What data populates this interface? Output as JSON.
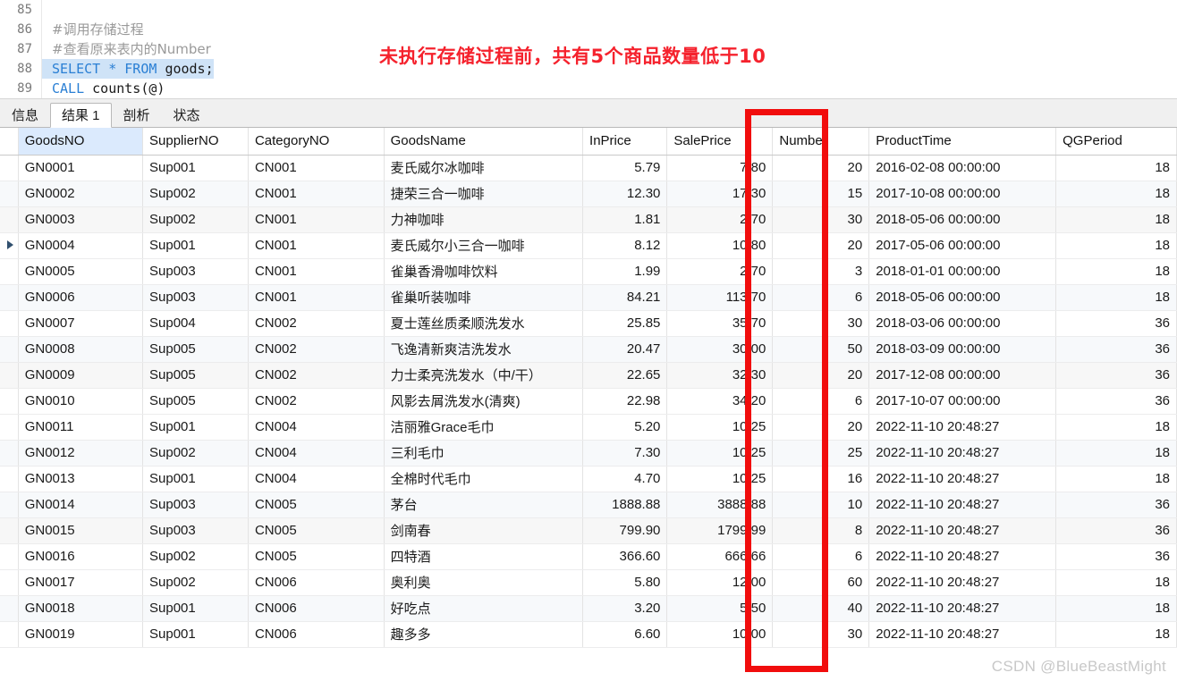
{
  "editor": {
    "lines": [
      {
        "no": "85",
        "tokens": [
          {
            "t": "",
            "cls": "plain"
          }
        ],
        "selected": false
      },
      {
        "no": "86",
        "tokens": [
          {
            "t": "#调用存储过程",
            "cls": "comment"
          }
        ],
        "selected": false
      },
      {
        "no": "87",
        "tokens": [
          {
            "t": "#查看原来表内的Number",
            "cls": "comment"
          }
        ],
        "selected": false
      },
      {
        "no": "88",
        "tokens": [
          {
            "t": "SELECT * FROM ",
            "cls": "kw"
          },
          {
            "t": "goods;",
            "cls": "plain"
          }
        ],
        "selected": true
      },
      {
        "no": "89",
        "tokens": [
          {
            "t": "CALL ",
            "cls": "kw"
          },
          {
            "t": "counts(@)",
            "cls": "plain"
          }
        ],
        "selected": false
      }
    ]
  },
  "annotation": {
    "text": "未执行存储过程前，共有5个商品数量低于10",
    "color": "#f5222d"
  },
  "tabs": [
    {
      "label": "信息",
      "active": false
    },
    {
      "label": "结果 1",
      "active": true
    },
    {
      "label": "剖析",
      "active": false
    },
    {
      "label": "状态",
      "active": false
    }
  ],
  "grid": {
    "columns": [
      {
        "key": "GoodsNO",
        "label": "GoodsNO",
        "align": "left",
        "highlight": true
      },
      {
        "key": "SupplierNO",
        "label": "SupplierNO",
        "align": "left",
        "highlight": false
      },
      {
        "key": "CategoryNO",
        "label": "CategoryNO",
        "align": "left",
        "highlight": false
      },
      {
        "key": "GoodsName",
        "label": "GoodsName",
        "align": "left",
        "highlight": false
      },
      {
        "key": "InPrice",
        "label": "InPrice",
        "align": "left",
        "highlight": false
      },
      {
        "key": "SalePrice",
        "label": "SalePrice",
        "align": "left",
        "highlight": false
      },
      {
        "key": "Number",
        "label": "Number",
        "align": "left",
        "highlight": false
      },
      {
        "key": "ProductTime",
        "label": "ProductTime",
        "align": "left",
        "highlight": false
      },
      {
        "key": "QGPeriod",
        "label": "QGPeriod",
        "align": "left",
        "highlight": false
      }
    ],
    "selected_row_index": 3,
    "rows": [
      {
        "GoodsNO": "GN0001",
        "SupplierNO": "Sup001",
        "CategoryNO": "CN001",
        "GoodsName": "麦氏威尔冰咖啡",
        "InPrice": "5.79",
        "SalePrice": "7.80",
        "Number": "20",
        "ProductTime": "2016-02-08 00:00:00",
        "QGPeriod": "18"
      },
      {
        "GoodsNO": "GN0002",
        "SupplierNO": "Sup002",
        "CategoryNO": "CN001",
        "GoodsName": "捷荣三合一咖啡",
        "InPrice": "12.30",
        "SalePrice": "17.30",
        "Number": "15",
        "ProductTime": "2017-10-08 00:00:00",
        "QGPeriod": "18"
      },
      {
        "GoodsNO": "GN0003",
        "SupplierNO": "Sup002",
        "CategoryNO": "CN001",
        "GoodsName": "力神咖啡",
        "InPrice": "1.81",
        "SalePrice": "2.70",
        "Number": "30",
        "ProductTime": "2018-05-06 00:00:00",
        "QGPeriod": "18"
      },
      {
        "GoodsNO": "GN0004",
        "SupplierNO": "Sup001",
        "CategoryNO": "CN001",
        "GoodsName": "麦氏威尔小三合一咖啡",
        "InPrice": "8.12",
        "SalePrice": "10.80",
        "Number": "20",
        "ProductTime": "2017-05-06 00:00:00",
        "QGPeriod": "18"
      },
      {
        "GoodsNO": "GN0005",
        "SupplierNO": "Sup003",
        "CategoryNO": "CN001",
        "GoodsName": "雀巢香滑咖啡饮料",
        "InPrice": "1.99",
        "SalePrice": "2.70",
        "Number": "3",
        "ProductTime": "2018-01-01 00:00:00",
        "QGPeriod": "18"
      },
      {
        "GoodsNO": "GN0006",
        "SupplierNO": "Sup003",
        "CategoryNO": "CN001",
        "GoodsName": "雀巢听装咖啡",
        "InPrice": "84.21",
        "SalePrice": "113.70",
        "Number": "6",
        "ProductTime": "2018-05-06 00:00:00",
        "QGPeriod": "18"
      },
      {
        "GoodsNO": "GN0007",
        "SupplierNO": "Sup004",
        "CategoryNO": "CN002",
        "GoodsName": "夏士莲丝质柔顺洗发水",
        "InPrice": "25.85",
        "SalePrice": "35.70",
        "Number": "30",
        "ProductTime": "2018-03-06 00:00:00",
        "QGPeriod": "36"
      },
      {
        "GoodsNO": "GN0008",
        "SupplierNO": "Sup005",
        "CategoryNO": "CN002",
        "GoodsName": "飞逸清新爽洁洗发水",
        "InPrice": "20.47",
        "SalePrice": "30.00",
        "Number": "50",
        "ProductTime": "2018-03-09 00:00:00",
        "QGPeriod": "36"
      },
      {
        "GoodsNO": "GN0009",
        "SupplierNO": "Sup005",
        "CategoryNO": "CN002",
        "GoodsName": "力士柔亮洗发水（中/干）",
        "InPrice": "22.65",
        "SalePrice": "32.30",
        "Number": "20",
        "ProductTime": "2017-12-08 00:00:00",
        "QGPeriod": "36"
      },
      {
        "GoodsNO": "GN0010",
        "SupplierNO": "Sup005",
        "CategoryNO": "CN002",
        "GoodsName": "风影去屑洗发水(清爽)",
        "InPrice": "22.98",
        "SalePrice": "34.20",
        "Number": "6",
        "ProductTime": "2017-10-07 00:00:00",
        "QGPeriod": "36"
      },
      {
        "GoodsNO": "GN0011",
        "SupplierNO": "Sup001",
        "CategoryNO": "CN004",
        "GoodsName": "洁丽雅Grace毛巾",
        "InPrice": "5.20",
        "SalePrice": "10.25",
        "Number": "20",
        "ProductTime": "2022-11-10 20:48:27",
        "QGPeriod": "18"
      },
      {
        "GoodsNO": "GN0012",
        "SupplierNO": "Sup002",
        "CategoryNO": "CN004",
        "GoodsName": "三利毛巾",
        "InPrice": "7.30",
        "SalePrice": "10.25",
        "Number": "25",
        "ProductTime": "2022-11-10 20:48:27",
        "QGPeriod": "18"
      },
      {
        "GoodsNO": "GN0013",
        "SupplierNO": "Sup001",
        "CategoryNO": "CN004",
        "GoodsName": "全棉时代毛巾",
        "InPrice": "4.70",
        "SalePrice": "10.25",
        "Number": "16",
        "ProductTime": "2022-11-10 20:48:27",
        "QGPeriod": "18"
      },
      {
        "GoodsNO": "GN0014",
        "SupplierNO": "Sup003",
        "CategoryNO": "CN005",
        "GoodsName": "茅台",
        "InPrice": "1888.88",
        "SalePrice": "3888.88",
        "Number": "10",
        "ProductTime": "2022-11-10 20:48:27",
        "QGPeriod": "36"
      },
      {
        "GoodsNO": "GN0015",
        "SupplierNO": "Sup003",
        "CategoryNO": "CN005",
        "GoodsName": "剑南春",
        "InPrice": "799.90",
        "SalePrice": "1799.99",
        "Number": "8",
        "ProductTime": "2022-11-10 20:48:27",
        "QGPeriod": "36"
      },
      {
        "GoodsNO": "GN0016",
        "SupplierNO": "Sup002",
        "CategoryNO": "CN005",
        "GoodsName": "四特酒",
        "InPrice": "366.60",
        "SalePrice": "666.66",
        "Number": "6",
        "ProductTime": "2022-11-10 20:48:27",
        "QGPeriod": "36"
      },
      {
        "GoodsNO": "GN0017",
        "SupplierNO": "Sup002",
        "CategoryNO": "CN006",
        "GoodsName": "奥利奥",
        "InPrice": "5.80",
        "SalePrice": "12.00",
        "Number": "60",
        "ProductTime": "2022-11-10 20:48:27",
        "QGPeriod": "18"
      },
      {
        "GoodsNO": "GN0018",
        "SupplierNO": "Sup001",
        "CategoryNO": "CN006",
        "GoodsName": "好吃点",
        "InPrice": "3.20",
        "SalePrice": "5.50",
        "Number": "40",
        "ProductTime": "2022-11-10 20:48:27",
        "QGPeriod": "18"
      },
      {
        "GoodsNO": "GN0019",
        "SupplierNO": "Sup001",
        "CategoryNO": "CN006",
        "GoodsName": "趣多多",
        "InPrice": "6.60",
        "SalePrice": "10.00",
        "Number": "30",
        "ProductTime": "2022-11-10 20:48:27",
        "QGPeriod": "18"
      }
    ]
  },
  "highlight_box": {
    "target_column": "Number",
    "color": "#f10d0d"
  },
  "watermark": {
    "text": "CSDN @BlueBeastMight"
  }
}
